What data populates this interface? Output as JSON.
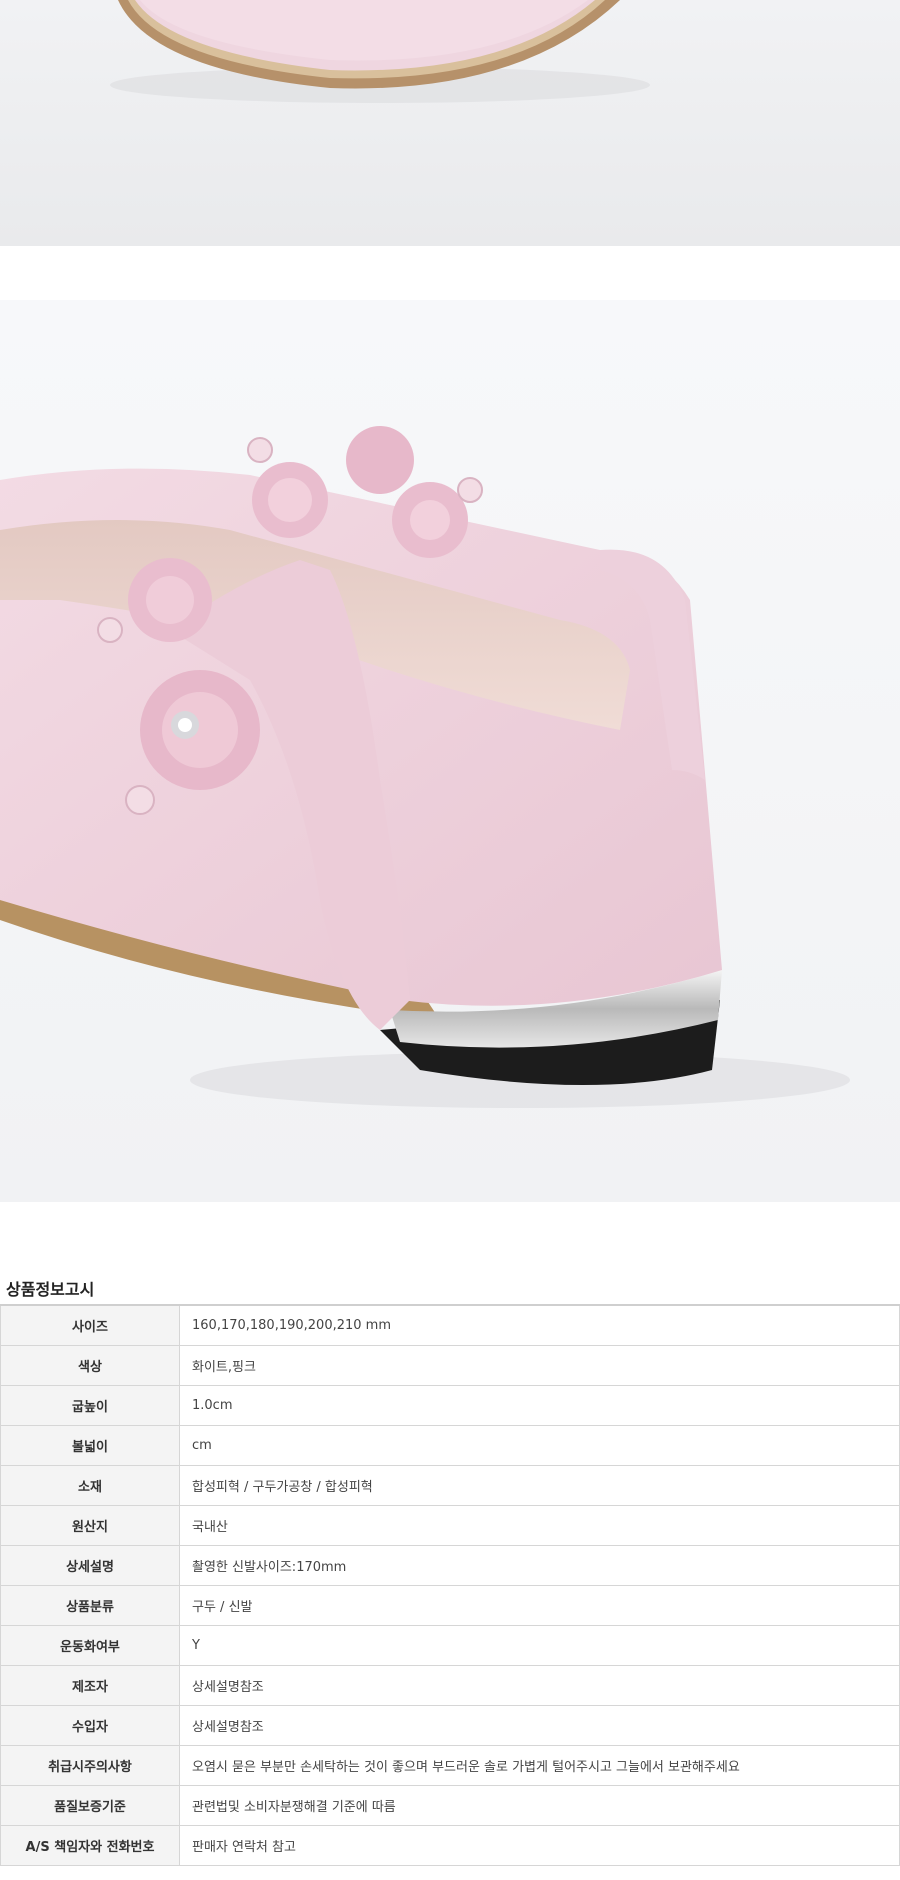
{
  "images": {
    "top_photo": "shoe-toe-closeup-photo",
    "main_photo": "shoe-heel-strap-photo"
  },
  "colors": {
    "glitter_pink": "#efd3de",
    "sole_tan": "#b79262",
    "heel_black": "#1c1c1c",
    "table_key_bg": "#f4f4f4",
    "table_border": "#d6d6d6"
  },
  "notice": {
    "title": "상품정보고시",
    "rows": [
      {
        "key": "사이즈",
        "value": "160,170,180,190,200,210 mm"
      },
      {
        "key": "색상",
        "value": "화이트,핑크"
      },
      {
        "key": "굽높이",
        "value": "1.0cm"
      },
      {
        "key": "볼넓이",
        "value": "cm"
      },
      {
        "key": "소재",
        "value": "합성피혁 / 구두가공창 / 합성피혁"
      },
      {
        "key": "원산지",
        "value": "국내산"
      },
      {
        "key": "상세설명",
        "value": "촬영한 신발사이즈:170mm"
      },
      {
        "key": "상품분류",
        "value": "구두 / 신발"
      },
      {
        "key": "운동화여부",
        "value": "Y"
      },
      {
        "key": "제조자",
        "value": "상세설명참조"
      },
      {
        "key": "수입자",
        "value": "상세설명참조"
      },
      {
        "key": "취급시주의사항",
        "value": "오염시 묻은 부분만 손세탁하는 것이 좋으며 부드러운 솔로 가볍게 털어주시고 그늘에서 보관해주세요"
      },
      {
        "key": "품질보증기준",
        "value": "관련법및 소비자분쟁해결 기준에 따름"
      },
      {
        "key": "A/S 책임자와 전화번호",
        "value": "판매자 연락처 참고"
      }
    ]
  }
}
